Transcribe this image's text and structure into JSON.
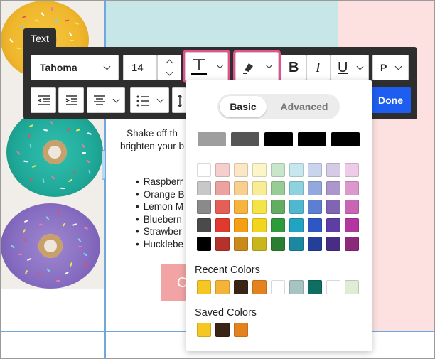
{
  "colors": {
    "accent_pink": "#e94f8a",
    "done_blue": "#1d5ef0",
    "toolbar_dark": "#2e2e2e"
  },
  "toolbar": {
    "tag": "Text",
    "font_family": "Tahoma",
    "font_size": "14",
    "bold": "B",
    "italic": "I",
    "underline": "U",
    "paragraph": "P",
    "done": "Done",
    "icons": [
      "text-color-icon",
      "highlight-icon",
      "outdent-icon",
      "indent-icon",
      "align-center-icon",
      "list-icon",
      "line-height-icon"
    ]
  },
  "email": {
    "body_line1": "Shake off th",
    "body_line2": "brighten your b",
    "fruits": [
      "Raspberr",
      "Orange B",
      "Lemon M",
      "Bluebern",
      "Strawber",
      "Hucklebe"
    ],
    "cta_text": "C"
  },
  "picker": {
    "tab_basic": "Basic",
    "tab_advanced": "Advanced",
    "grays": [
      "#9e9e9e",
      "#555555",
      "#000000",
      "#000000",
      "#000000"
    ],
    "grid": [
      [
        "#ffffff",
        "#f5cfcd",
        "#fbe7c6",
        "#fbf5c7",
        "#c9e6c9",
        "#c6e7ee",
        "#c9d4ee",
        "#d5cbe6",
        "#eecbe6"
      ],
      [
        "#c8c8c8",
        "#eca29e",
        "#f8cf8e",
        "#f8ec95",
        "#97cc97",
        "#8ed1df",
        "#93a9dd",
        "#ab97cc",
        "#dc97cc"
      ],
      [
        "#8a8a8a",
        "#e35f58",
        "#f6b43f",
        "#f5e34a",
        "#63ad63",
        "#4fb8cf",
        "#5c7fcf",
        "#8165b3",
        "#c866b3"
      ],
      [
        "#4a4a4a",
        "#e03a30",
        "#f5a014",
        "#f1d51e",
        "#2e9b3a",
        "#21a3c2",
        "#2e57c4",
        "#5e3ea5",
        "#b3359e"
      ],
      [
        "#000000",
        "#b33229",
        "#c98a1b",
        "#c9b51c",
        "#2a7e31",
        "#1c87a1",
        "#233f99",
        "#472d84",
        "#8c2a7a"
      ]
    ],
    "recent_label": "Recent Colors",
    "recent": [
      "#f6c623",
      "#f4b43a",
      "#3a2416",
      "#e4831e",
      "#ffffff",
      "#a7c4c2",
      "#0e6e61",
      "#ffffff",
      "#dfecd6"
    ],
    "saved_label": "Saved Colors",
    "saved": [
      "#f6c623",
      "#3a2416",
      "#e4831e"
    ]
  }
}
